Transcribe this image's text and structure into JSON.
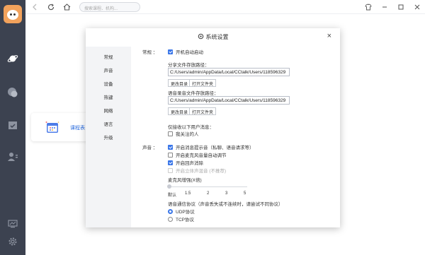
{
  "topbar": {
    "search_placeholder": "搜索课程、机构..."
  },
  "bgcard": {
    "label": "课程表"
  },
  "dialog": {
    "title": "系统设置",
    "close": "×",
    "nav": [
      "常规",
      "声音",
      "设备",
      "热键",
      "网络",
      "语言",
      "升级"
    ],
    "general": {
      "section": "常规 ：",
      "autostart": "开机自动启动",
      "share_path_label": "分享文件存放路径：",
      "share_path": "C:/Users/admin/AppData/Local/CCtalk/Users/118596329",
      "change_dir": "更改目录",
      "open_folder": "打开文件夹",
      "record_path_label": "语音录音文件存放路径：",
      "record_path": "C:/Users/admin/AppData/Local/CCtalk/Users/118596329",
      "msg_label": "仅接收以下用户消息：",
      "msg_option": "我关注的人"
    },
    "sound": {
      "section": "声音 ：",
      "opt1": "开启消息提示音（私聊、语音请求等）",
      "opt2": "开启麦克风音量自动调节",
      "opt3": "开启回声消除",
      "opt4": "开启立体声混音 (不推荐)",
      "amp_label": "麦克风增强(X倍)",
      "ticks": [
        "默认",
        "1.5",
        "2",
        "3",
        "5"
      ],
      "amp_level": 0,
      "protocol_label": "语音通信协议（声音丢失或不连续时，请尝试不同协议）",
      "udp": "UDP协议",
      "tcp": "TCP协议"
    }
  },
  "colors": {
    "accent": "#3a76e8",
    "rail": "#3c4250"
  }
}
